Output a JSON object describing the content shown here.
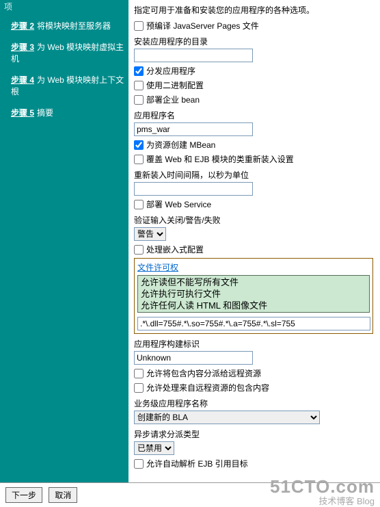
{
  "sidebar": {
    "header": "项",
    "steps": [
      {
        "link": "步骤 2",
        "desc": "将模块映射至服务器"
      },
      {
        "link": "步骤 3",
        "desc": "为 Web 模块映射虚拟主机"
      },
      {
        "link": "步骤 4",
        "desc": "为 Web 模块映射上下文根"
      },
      {
        "link": "步骤 5",
        "desc": "摘要"
      }
    ]
  },
  "main": {
    "intro": "指定可用于准备和安装您的应用程序的各种选项。",
    "precompile": {
      "label": "预编译 JavaServer Pages 文件",
      "checked": false
    },
    "installDirLabel": "安装应用程序的目录",
    "installDirValue": "",
    "distribute": {
      "label": "分发应用程序",
      "checked": true
    },
    "useBinary": {
      "label": "使用二进制配置",
      "checked": false
    },
    "deployEjb": {
      "label": "部署企业 bean",
      "checked": false
    },
    "appNameLabel": "应用程序名",
    "appNameValue": "pms_war",
    "createMBean": {
      "label": "为资源创建 MBean",
      "checked": true
    },
    "override": {
      "label": "覆盖 Web 和 EJB 模块的类重新装入设置",
      "checked": false
    },
    "reloadLabel": "重新装入时间间隔，以秒为单位",
    "reloadValue": "",
    "deployWS": {
      "label": "部署 Web Service",
      "checked": false
    },
    "validateLabel": "验证输入关闭/警告/失败",
    "validateValue": "警告",
    "embedded": {
      "label": "处理嵌入式配置",
      "checked": false
    },
    "permGroup": {
      "title": "文件许可权",
      "lines": [
        "允许读但不能写所有文件",
        "允许执行可执行文件",
        "允许任何人读 HTML 和图像文件"
      ],
      "value": ".*\\.dll=755#.*\\.so=755#.*\\.a=755#.*\\.sl=755"
    },
    "buildIdLabel": "应用程序构建标识",
    "buildIdValue": "Unknown",
    "allowInclude": {
      "label": "允许将包含内容分派给远程资源",
      "checked": false
    },
    "allowProcess": {
      "label": "允许处理来自远程资源的包含内容",
      "checked": false
    },
    "blaLabel": "业务级应用程序名称",
    "blaValue": "创建新的 BLA",
    "asyncLabel": "异步请求分派类型",
    "asyncValue": "已禁用",
    "autoResolve": {
      "label": "允许自动解析 EJB 引用目标",
      "checked": false
    }
  },
  "footer": {
    "next": "下一步",
    "cancel": "取消"
  },
  "watermark": {
    "big": "51CTO.com",
    "small": "技术博客   Blog"
  }
}
